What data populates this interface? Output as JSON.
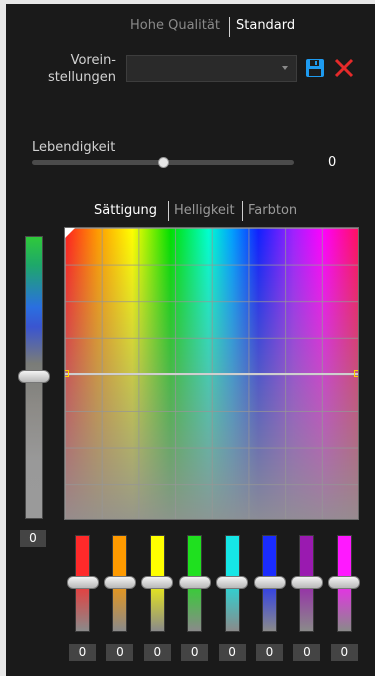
{
  "mode": {
    "hq_label": "Hohe Qualität",
    "std_label": "Standard"
  },
  "presets": {
    "label_line1": "Vorein-",
    "label_line2": "stellungen",
    "selected": ""
  },
  "vibrance": {
    "label": "Lebendigkeit",
    "value": "0",
    "position": 0.5
  },
  "tabs": {
    "saturation": "Sättigung",
    "brightness": "Helligkeit",
    "hue": "Farbton"
  },
  "master": {
    "value": "0"
  },
  "channels": [
    {
      "color": "#ff2a2a",
      "value": "0"
    },
    {
      "color": "#ff9a00",
      "value": "0"
    },
    {
      "color": "#ffff00",
      "value": "0"
    },
    {
      "color": "#1fe01f",
      "value": "0"
    },
    {
      "color": "#16e6e6",
      "value": "0"
    },
    {
      "color": "#1a2cff",
      "value": "0"
    },
    {
      "color": "#9a1ab0",
      "value": "0"
    },
    {
      "color": "#ff19ff",
      "value": "0"
    }
  ],
  "icons": {
    "save": "floppy-disk-icon",
    "close": "close-x-icon"
  }
}
